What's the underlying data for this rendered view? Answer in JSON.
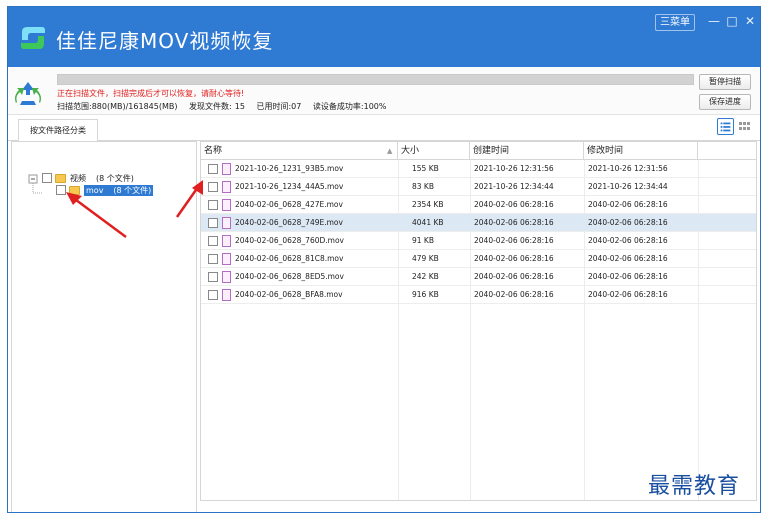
{
  "colors": {
    "accent": "#2f7ad2",
    "warning": "#e02020",
    "primary_button": "#f07a2a",
    "selected_row": "#dde8f5",
    "watermark": "#1a4fa0"
  },
  "header": {
    "title": "佳佳尼康MOV视频恢复",
    "menu_label": "三菜单",
    "minimize": "—",
    "maximize": "□",
    "close": "✕"
  },
  "status": {
    "progress": 1.0,
    "message": "正在扫描文件，扫描完成后才可以恢复，请耐心等待!",
    "scan_range_label": "扫描范围:",
    "scan_range_value": "880(MB)/161845(MB)",
    "found_label": "发现文件数:",
    "found_value": "15",
    "elapsed_label": "已用时间:",
    "elapsed_value": "07",
    "read_rate_label": "读设备成功率:",
    "read_rate_value": "100%",
    "pause_button": "暂停扫描",
    "save_button": "保存进度"
  },
  "tabs": [
    {
      "label": "按文件路径分类",
      "active": true
    }
  ],
  "view_buttons": [
    "list-view-icon",
    "grid-view-icon"
  ],
  "tree": {
    "root": {
      "label": "视频",
      "count": "(8 个文件)"
    },
    "child": {
      "label": "mov",
      "count": "(8 个文件)"
    }
  },
  "list": {
    "columns": [
      "名称",
      "大小",
      "创建时间",
      "修改时间"
    ],
    "rows": [
      {
        "name": "2021-10-26_1231_93B5.mov",
        "size": "155 KB",
        "created": "2021-10-26 12:31:56",
        "modified": "2021-10-26 12:31:56",
        "selected": false
      },
      {
        "name": "2021-10-26_1234_44A5.mov",
        "size": "83 KB",
        "created": "2021-10-26 12:34:44",
        "modified": "2021-10-26 12:34:44",
        "selected": false
      },
      {
        "name": "2040-02-06_0628_427E.mov",
        "size": "2354 KB",
        "created": "2040-02-06 06:28:16",
        "modified": "2040-02-06 06:28:16",
        "selected": false
      },
      {
        "name": "2040-02-06_0628_749E.mov",
        "size": "4041 KB",
        "created": "2040-02-06 06:28:16",
        "modified": "2040-02-06 06:28:16",
        "selected": true
      },
      {
        "name": "2040-02-06_0628_760D.mov",
        "size": "91 KB",
        "created": "2040-02-06 06:28:16",
        "modified": "2040-02-06 06:28:16",
        "selected": false
      },
      {
        "name": "2040-02-06_0628_81C8.mov",
        "size": "479 KB",
        "created": "2040-02-06 06:28:16",
        "modified": "2040-02-06 06:28:16",
        "selected": false
      },
      {
        "name": "2040-02-06_0628_8ED5.mov",
        "size": "242 KB",
        "created": "2040-02-06 06:28:16",
        "modified": "2040-02-06 06:28:16",
        "selected": false
      },
      {
        "name": "2040-02-06_0628_BFA8.mov",
        "size": "916 KB",
        "created": "2040-02-06 06:28:16",
        "modified": "2040-02-06 06:28:16",
        "selected": false
      }
    ]
  },
  "watermark": "最需教育"
}
